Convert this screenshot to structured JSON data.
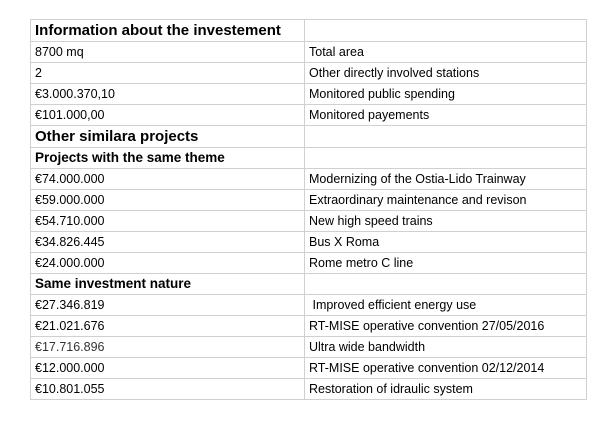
{
  "sheet": {
    "heading_info": "Information about the investement",
    "info_rows": [
      {
        "value": "8700 mq",
        "label": "Total area"
      },
      {
        "value": "2",
        "label": "Other directly involved stations"
      },
      {
        "value": "€3.000.370,10",
        "label": "Monitored public spending"
      },
      {
        "value": "€101.000,00",
        "label": "Monitored payements"
      }
    ],
    "heading_other": "Other similara projects",
    "heading_theme": "Projects with the same theme",
    "theme_rows": [
      {
        "value": "€74.000.000",
        "label": "Modernizing of the Ostia-Lido Trainway"
      },
      {
        "value": "€59.000.000",
        "label": "Extraordinary maintenance and revison"
      },
      {
        "value": "€54.710.000",
        "label": "New high speed trains"
      },
      {
        "value": "€34.826.445",
        "label": "Bus X Roma"
      },
      {
        "value": "€24.000.000",
        "label": "Rome metro C line"
      }
    ],
    "heading_nature": "Same investment nature",
    "nature_rows": [
      {
        "value": "€27.346.819",
        "label": " Improved efficient energy use"
      },
      {
        "value": "€21.021.676",
        "label": "RT-MISE operative convention 27/05/2016"
      },
      {
        "value": "€17.716.896",
        "label": "Ultra wide bandwidth"
      },
      {
        "value": "€12.000.000",
        "label": "RT-MISE operative convention 02/12/2014"
      },
      {
        "value": "€10.801.055",
        "label": "Restoration of idraulic system"
      }
    ]
  }
}
